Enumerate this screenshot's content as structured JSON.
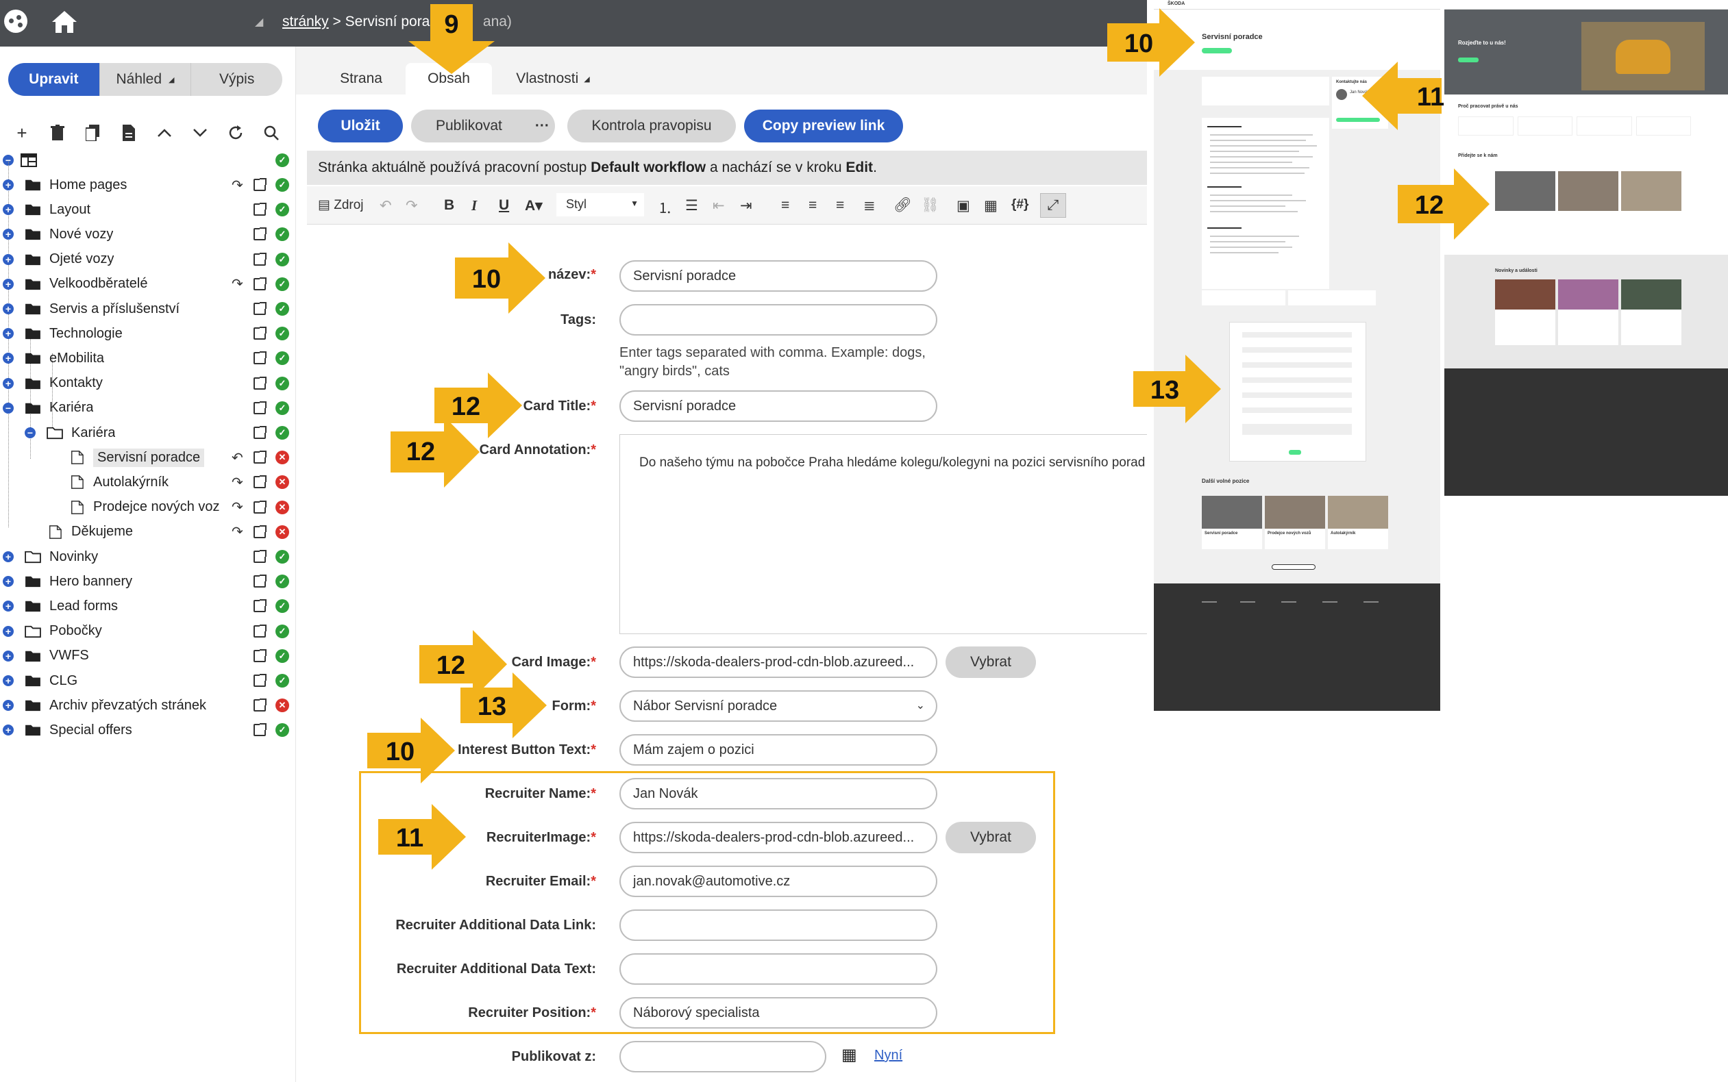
{
  "topbar": {
    "breadcrumb_link": "stránky",
    "breadcrumb_sep": ">",
    "breadcrumb_current": "Servisní porad",
    "breadcrumb_tail": "ana)"
  },
  "sidebar": {
    "modes": [
      "Upravit",
      "Náhled",
      "Výpis"
    ],
    "tree": [
      {
        "label": "Home pages",
        "status": "ok",
        "undo": true
      },
      {
        "label": "Layout",
        "status": "ok"
      },
      {
        "label": "Nové vozy",
        "status": "ok"
      },
      {
        "label": "Ojeté vozy",
        "status": "ok"
      },
      {
        "label": "Velkoodběratelé",
        "status": "ok",
        "undo": true
      },
      {
        "label": "Servis a příslušenství",
        "status": "ok"
      },
      {
        "label": "Technologie",
        "status": "ok"
      },
      {
        "label": "eMobilita",
        "status": "ok"
      },
      {
        "label": "Kontakty",
        "status": "ok"
      },
      {
        "label": "Kariéra",
        "status": "ok"
      },
      {
        "label": "Kariéra",
        "status": "ok"
      },
      {
        "label": "Servisní poradce",
        "status": "no"
      },
      {
        "label": "Autolakýrník",
        "status": "no"
      },
      {
        "label": "Prodejce nových voz",
        "status": "no"
      },
      {
        "label": "Děkujeme",
        "status": "no"
      },
      {
        "label": "Novinky",
        "status": "ok"
      },
      {
        "label": "Hero bannery",
        "status": "ok"
      },
      {
        "label": "Lead forms",
        "status": "ok"
      },
      {
        "label": "Pobočky",
        "status": "ok"
      },
      {
        "label": "VWFS",
        "status": "ok"
      },
      {
        "label": "CLG",
        "status": "ok"
      },
      {
        "label": "Archiv převzatých stránek",
        "status": "no"
      },
      {
        "label": "Special offers",
        "status": "ok"
      }
    ]
  },
  "tabs": [
    "Strana",
    "Obsah",
    "Vlastnosti"
  ],
  "toolbar": {
    "save": "Uložit",
    "publish": "Publikovat",
    "more": "···",
    "spellcheck": "Kontrola pravopisu",
    "copy_preview": "Copy preview link"
  },
  "workflow": {
    "prefix": "Stránka aktuálně používá pracovní postup ",
    "name": "Default workflow",
    "middle": " a nachází se v kroku ",
    "step": "Edit",
    "suffix": "."
  },
  "editor": {
    "source": "Zdroj",
    "style": "Styl"
  },
  "form": {
    "name_label": "název:",
    "name_value": "Servisní poradce",
    "tags_label": "Tags:",
    "tags_hint_1": "Enter tags separated with comma. Example: dogs,",
    "tags_hint_2": "\"angry birds\", cats",
    "card_title_label": "Card Title:",
    "card_title_value": "Servisní poradce",
    "card_annotation_label": "Card Annotation:",
    "card_annotation_value": "Do našeho týmu na pobočce Praha hledáme kolegu/kolegyni na pozici servisního porad",
    "card_image_label": "Card Image:",
    "card_image_value": "https://skoda-dealers-prod-cdn-blob.azureed...",
    "choose": "Vybrat",
    "form_label": "Form:",
    "form_value": "Nábor Servisní poradce",
    "interest_label": "Interest Button Text:",
    "interest_value": "Mám zajem o pozici",
    "recruiter_name_label": "Recruiter Name:",
    "recruiter_name_value": "Jan Novák",
    "recruiter_image_label": "RecruiterImage:",
    "recruiter_image_value": "https://skoda-dealers-prod-cdn-blob.azureed...",
    "recruiter_email_label": "Recruiter Email:",
    "recruiter_email_value": "jan.novak@automotive.cz",
    "recruiter_link_label": "Recruiter Additional Data Link:",
    "recruiter_text_label": "Recruiter Additional Data Text:",
    "recruiter_position_label": "Recruiter Position:",
    "recruiter_position_value": "Náborový specialista",
    "publish_from_label": "Publikovat z:",
    "now_link": "Nyní",
    "required_mark": "*"
  },
  "callouts": [
    "9",
    "10",
    "10",
    "12",
    "12",
    "12",
    "13",
    "10",
    "11",
    "10",
    "11",
    "12",
    "13"
  ],
  "preview": {
    "page_title": "Servisní poradce",
    "contact_heading": "Kontaktujte nás",
    "contact_name": "Jan Novák",
    "other_positions": "Další volné pozice",
    "cards": [
      "Servisní poradce",
      "Prodejce nových vozů",
      "Autolakýrník"
    ],
    "hero_text": "Rozjeďte to u nás!",
    "why_heading": "Proč pracovat právě u nás",
    "join_heading": "Přidejte se k nám",
    "news_heading": "Novinky a události"
  },
  "colors": {
    "accent_blue": "#2f5fc5",
    "callout_yellow": "#f3b31b",
    "ok_green": "#2e9e3a",
    "error_red": "#d9322b"
  }
}
